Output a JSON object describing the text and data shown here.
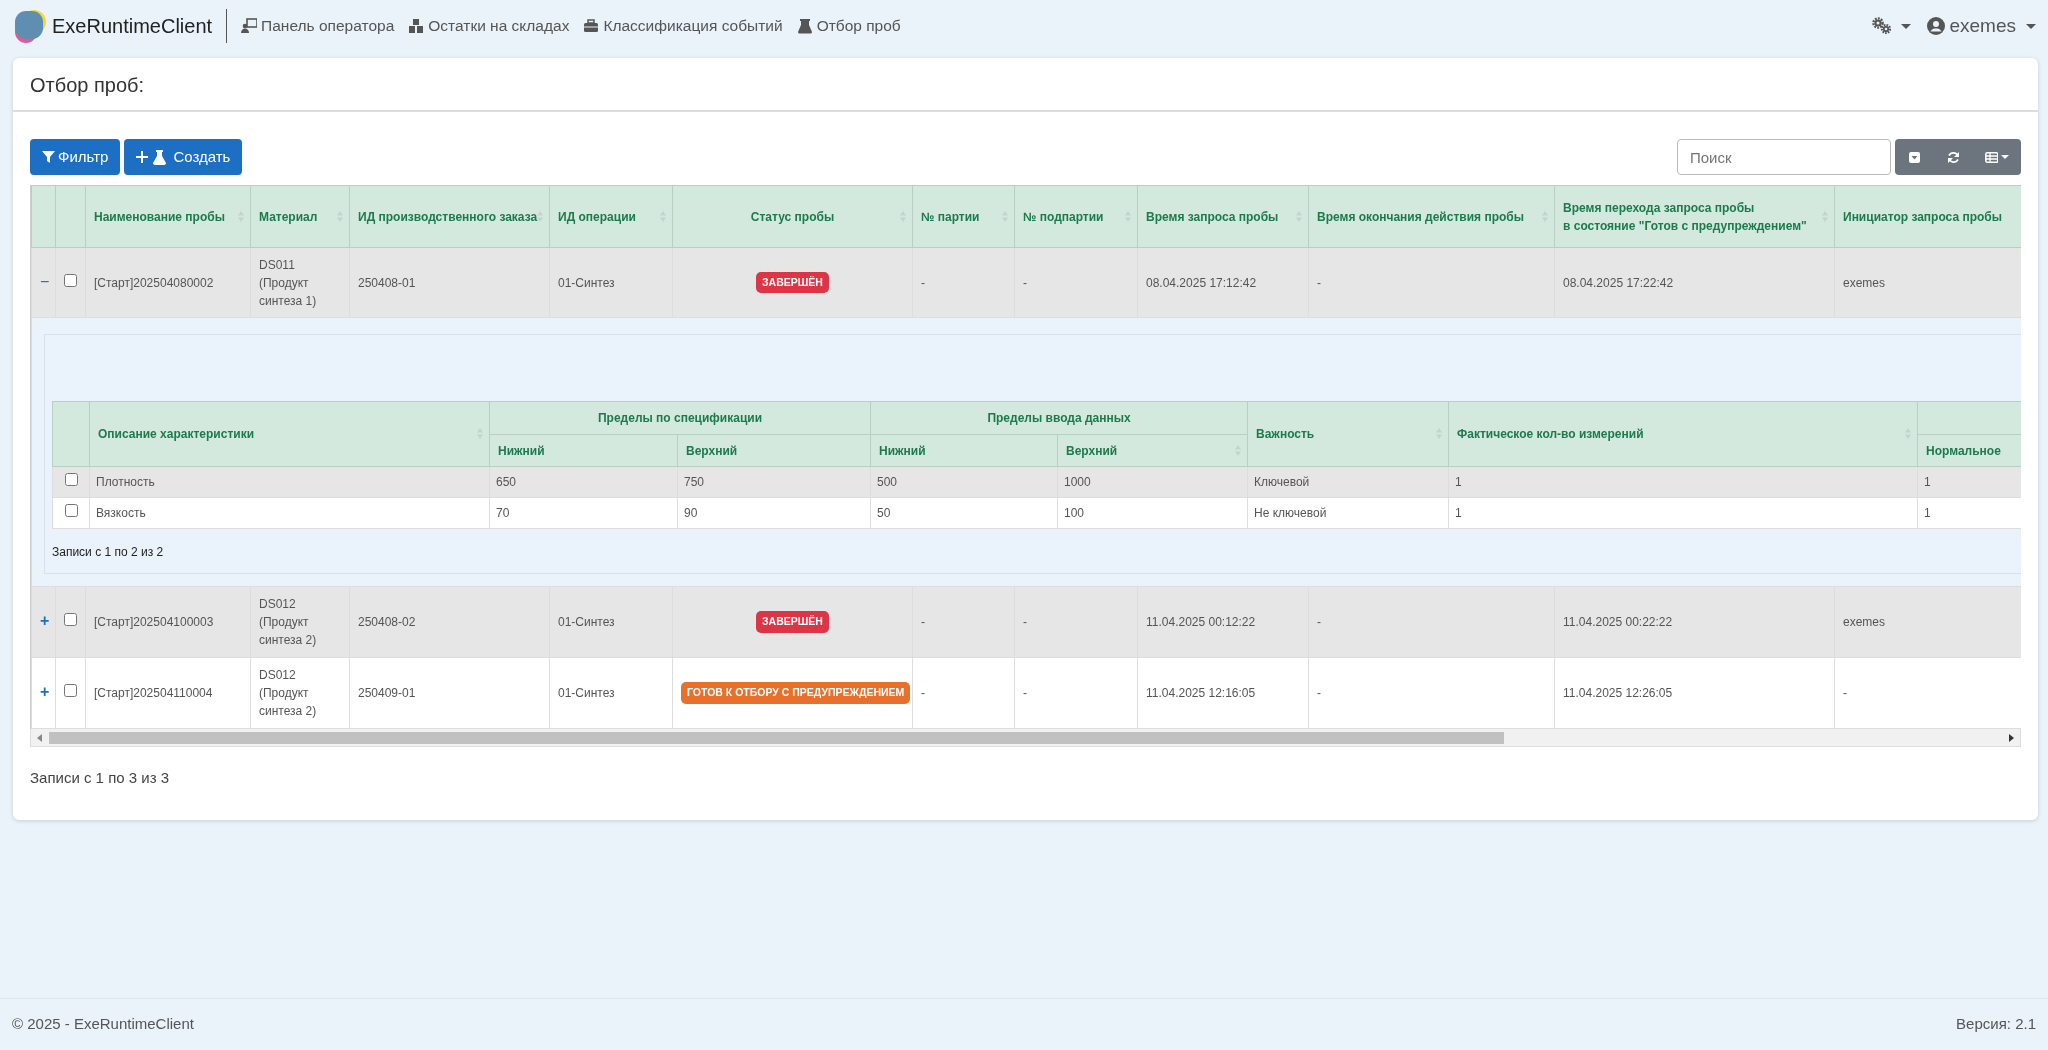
{
  "navbar": {
    "brand": "ExeRuntimeClient",
    "links": [
      {
        "label": "Панель оператора"
      },
      {
        "label": "Остатки на складах"
      },
      {
        "label": "Классификация событий"
      },
      {
        "label": "Отбор проб"
      }
    ],
    "user": "exemes"
  },
  "page": {
    "title": "Отбор проб:"
  },
  "toolbar": {
    "buttons": [
      "Фильтр",
      "Создать"
    ],
    "search": {
      "placeholder": "Поиск"
    }
  },
  "table": {
    "columns": [
      {
        "label": "Наименование пробы",
        "sortable": true
      },
      {
        "label": "Материал",
        "sortable": true
      },
      {
        "label": "ИД производственного заказа",
        "sortable": true
      },
      {
        "label": "ИД операции",
        "sortable": true
      },
      {
        "label": "Статус пробы",
        "sortable": true
      },
      {
        "label": "№ партии",
        "sortable": true
      },
      {
        "label": "№ подпартии",
        "sortable": true
      },
      {
        "label": "Время запроса пробы",
        "sortable": true
      },
      {
        "label": "Время окончания действия пробы",
        "sortable": true
      },
      {
        "label": "Время перехода запроса пробы\nв состояние \"Готов с предупреждением\"",
        "sortable": true
      },
      {
        "label": "Инициатор запроса пробы"
      }
    ],
    "rows": [
      {
        "toggle": "−",
        "expanded": true,
        "checked": false,
        "name": "[Старт]202504080002",
        "material": "DS011 (Продукт синтеза 1)",
        "order": "250408-01",
        "operation": "01-Синтез",
        "status": {
          "text": "ЗАВЕРШЁН",
          "color": "#dc3545"
        },
        "batch": "-",
        "subbatch": "-",
        "request_time": "08.04.2025 17:12:42",
        "end_time": "-",
        "transition_time": "08.04.2025 17:22:42",
        "initiator": "exemes",
        "detail": {
          "header_rows": [
            {
              "cells": [
                {
                  "label": "Описание характеристики",
                  "sortable": true,
                  "rowspan": 2
                },
                {
                  "label": "Пределы по спецификации",
                  "sortable": false,
                  "colspan": 2
                },
                {
                  "label": "Пределы ввода данных",
                  "sortable": false,
                  "colspan": 2
                },
                {
                  "label": "Важность",
                  "sortable": true,
                  "rowspan": 2
                },
                {
                  "label": "Фактическое кол-во измерений",
                  "sortable": true,
                  "rowspan": 2
                },
                {
                  "sortable": false
                }
              ]
            },
            {
              "cells": [
                {
                  "label": "Нижний",
                  "sortable": false
                },
                {
                  "label": "Верхний",
                  "sortable": false
                },
                {
                  "label": "Нижний",
                  "sortable": false
                },
                {
                  "label": "Верхний",
                  "sortable": true
                },
                {
                  "label": "Нормальное",
                  "sortable": false
                }
              ]
            }
          ],
          "rows": [
            {
              "checked": false,
              "cells": [
                "Плотность",
                "650",
                "750",
                "500",
                "1000",
                "Ключевой",
                "1",
                "1"
              ]
            },
            {
              "checked": false,
              "cells": [
                "Вязкость",
                "70",
                "90",
                "50",
                "100",
                "Не ключевой",
                "1",
                "1"
              ]
            }
          ],
          "summary": "Записи с 1 по 2 из 2"
        }
      },
      {
        "toggle": "+",
        "expanded": false,
        "checked": false,
        "name": "[Старт]202504100003",
        "material": "DS012 (Продукт синтеза 2)",
        "order": "250408-02",
        "operation": "01-Синтез",
        "status": {
          "text": "ЗАВЕРШЁН",
          "color": "#dc3545"
        },
        "batch": "-",
        "subbatch": "-",
        "request_time": "11.04.2025 00:12:22",
        "end_time": "-",
        "transition_time": "11.04.2025 00:22:22",
        "initiator": "exemes"
      },
      {
        "toggle": "+",
        "expanded": false,
        "checked": false,
        "name": "[Старт]202504110004",
        "material": "DS012 (Продукт синтеза 2)",
        "order": "250409-01",
        "operation": "01-Синтез",
        "status": {
          "text": "ГОТОВ К ОТБОРУ С ПРЕДУПРЕЖДЕНИЕМ",
          "color": "#e8702a"
        },
        "batch": "-",
        "subbatch": "-",
        "request_time": "11.04.2025 12:16:05",
        "end_time": "-",
        "transition_time": "11.04.2025 12:26:05",
        "initiator": "-"
      }
    ],
    "summary": "Записи с 1 по 3 из 3"
  },
  "footer": {
    "copyright": "© 2025 - ExeRuntimeClient",
    "version": "Версия: 2.1"
  }
}
